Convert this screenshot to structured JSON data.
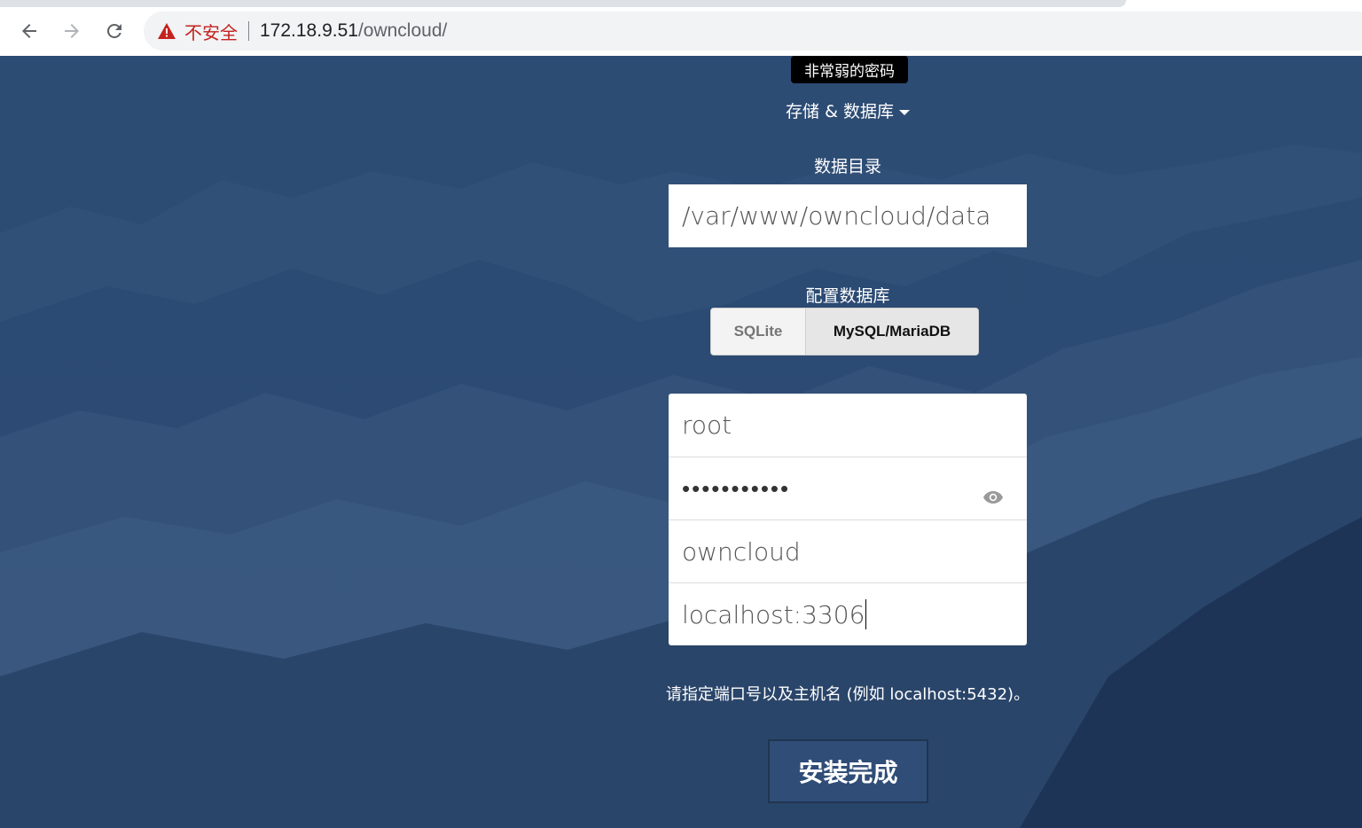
{
  "browser": {
    "security_label": "不安全",
    "url_host": "172.18.9.51",
    "url_path": "/owncloud/"
  },
  "page": {
    "tooltip": "非常弱的密码",
    "storage_toggle_label": "存储 & 数据库",
    "data_dir_label": "数据目录",
    "data_dir_value": "/var/www/owncloud/data",
    "db_config_label": "配置数据库",
    "db_options": [
      "SQLite",
      "MySQL/MariaDB"
    ],
    "db_selected": "MySQL/MariaDB",
    "db_user": "root",
    "db_password_masked": "•••••••••••",
    "db_name": "owncloud",
    "db_host": "localhost:3306",
    "hint": "请指定端口号以及主机名 (例如 localhost:5432)。",
    "install_button": "安装完成"
  },
  "colors": {
    "background": "#2e4f7a",
    "button": "#2f4d77",
    "insecure_red": "#c5221f"
  }
}
